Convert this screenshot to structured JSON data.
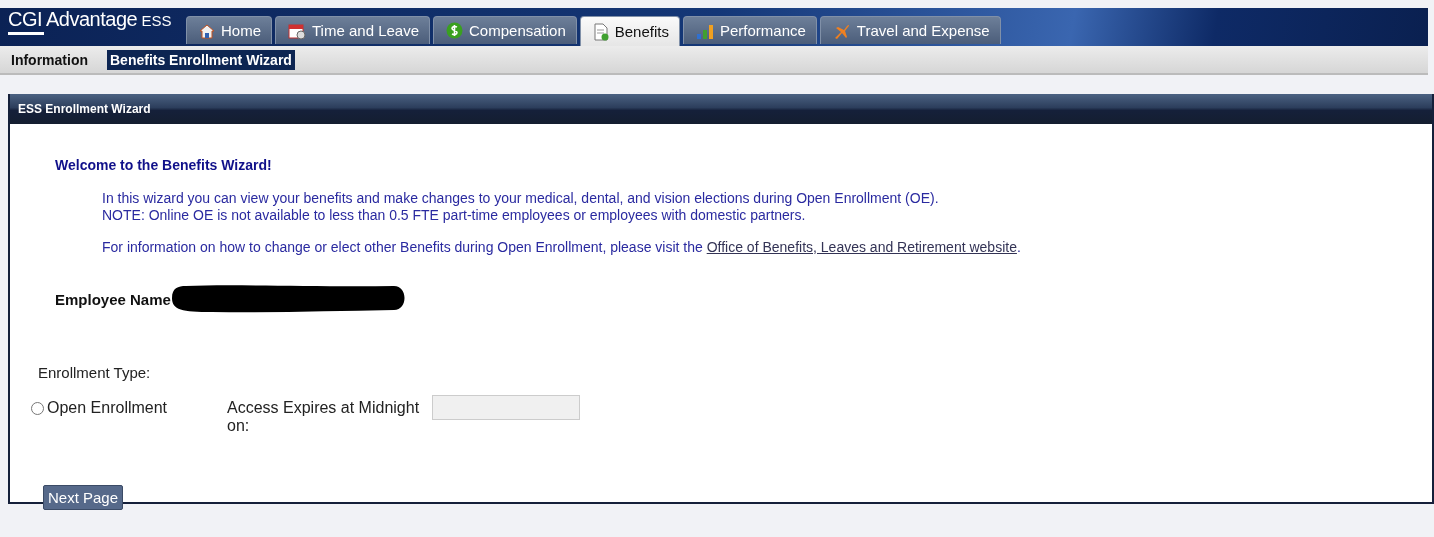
{
  "app": {
    "logo": "CGI Advantage",
    "logo_suffix": "ESS"
  },
  "tabs": [
    {
      "label": "Home",
      "selected": false
    },
    {
      "label": "Time and Leave",
      "selected": false
    },
    {
      "label": "Compensation",
      "selected": false
    },
    {
      "label": "Benefits",
      "selected": true
    },
    {
      "label": "Performance",
      "selected": false
    },
    {
      "label": "Travel and Expense",
      "selected": false
    }
  ],
  "subtabs": [
    {
      "label": "Information",
      "selected": false
    },
    {
      "label": "Benefits Enrollment Wizard",
      "selected": true
    }
  ],
  "panel": {
    "title": "ESS Enrollment Wizard",
    "heading": "Welcome to the Benefits Wizard!",
    "intro": [
      "In this wizard you can view your benefits and make changes to your medical, dental, and vision elections during Open Enrollment (OE).",
      "NOTE: Online OE is not available to less than 0.5 FTE part-time employees or employees with domestic partners."
    ],
    "info": "For information on how to change or elect other Benefits during Open Enrollment, please visit the",
    "info_link": "Office of Benefits, Leaves and Retirement website",
    "info_end": ".",
    "employee_label": "Employee Name",
    "employee_redacted": true,
    "enrollment_type_label": "Enrollment Type:",
    "options": [
      {
        "label": "Open Enrollment",
        "selected": false
      }
    ],
    "expires_label": "Access Expires at Midnight on:",
    "next_button": "Next Page"
  }
}
